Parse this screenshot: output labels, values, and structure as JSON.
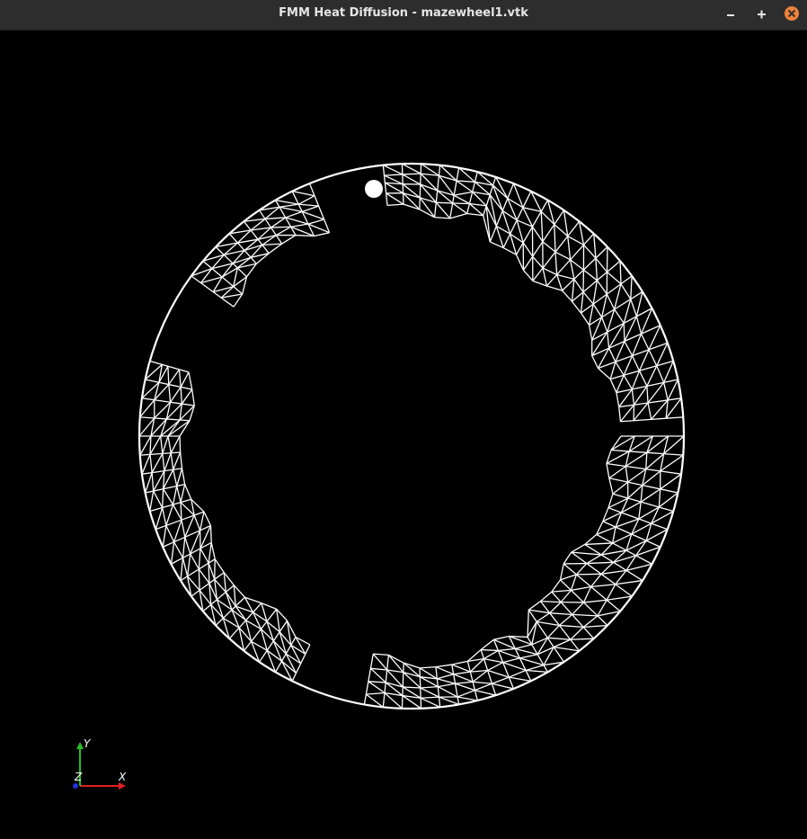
{
  "window": {
    "title": "FMM Heat Diffusion - mazewheel1.vtk",
    "minimize_icon": "minimize-icon",
    "maximize_icon": "maximize-icon",
    "close_icon": "close-icon",
    "close_color": "#f0843c"
  },
  "viewport": {
    "background": "#000000",
    "mesh_color": "#ffffff"
  },
  "axes": {
    "x_label": "X",
    "y_label": "Y",
    "z_label": "Z",
    "x_color": "#e02020",
    "y_color": "#20c020",
    "z_color": "#2030e0"
  }
}
